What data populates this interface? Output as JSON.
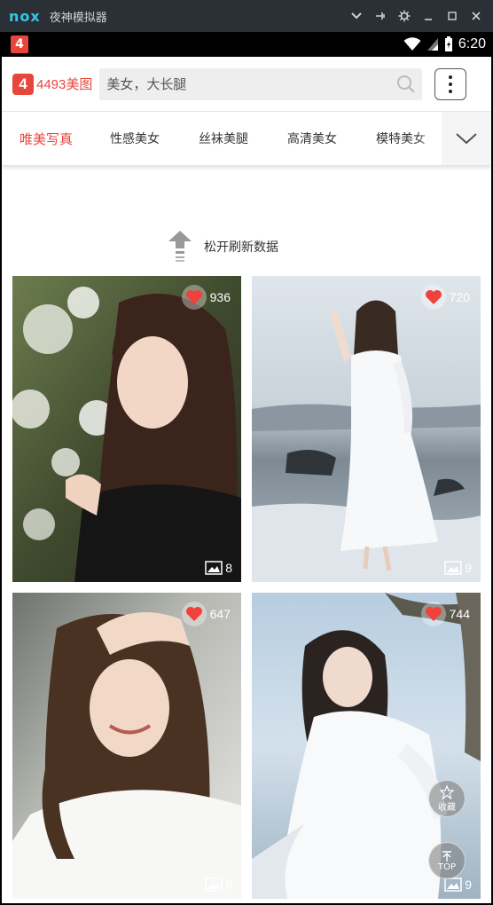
{
  "window": {
    "logo": "nox",
    "title": "夜神模拟器"
  },
  "statusbar": {
    "app_icon": "4",
    "time": "6:20"
  },
  "header": {
    "brand_mark": "4",
    "brand_text": "4493美图",
    "search_placeholder": "美女，大长腿"
  },
  "tabs": {
    "items": [
      {
        "label": "唯美写真",
        "active": true
      },
      {
        "label": "性感美女"
      },
      {
        "label": "丝袜美腿"
      },
      {
        "label": "高清美女"
      },
      {
        "label": "模特美女"
      }
    ]
  },
  "refresh": {
    "text": "松开刷新数据"
  },
  "cards": [
    {
      "likes": "936",
      "images": "8"
    },
    {
      "likes": "720",
      "images": "9"
    },
    {
      "likes": "647",
      "images": "8"
    },
    {
      "likes": "744",
      "images": "9"
    }
  ],
  "floating": {
    "favorite_label": "收藏",
    "top_label": "TOP"
  },
  "colors": {
    "accent": "#e8463c",
    "heart": "#f0413c"
  }
}
